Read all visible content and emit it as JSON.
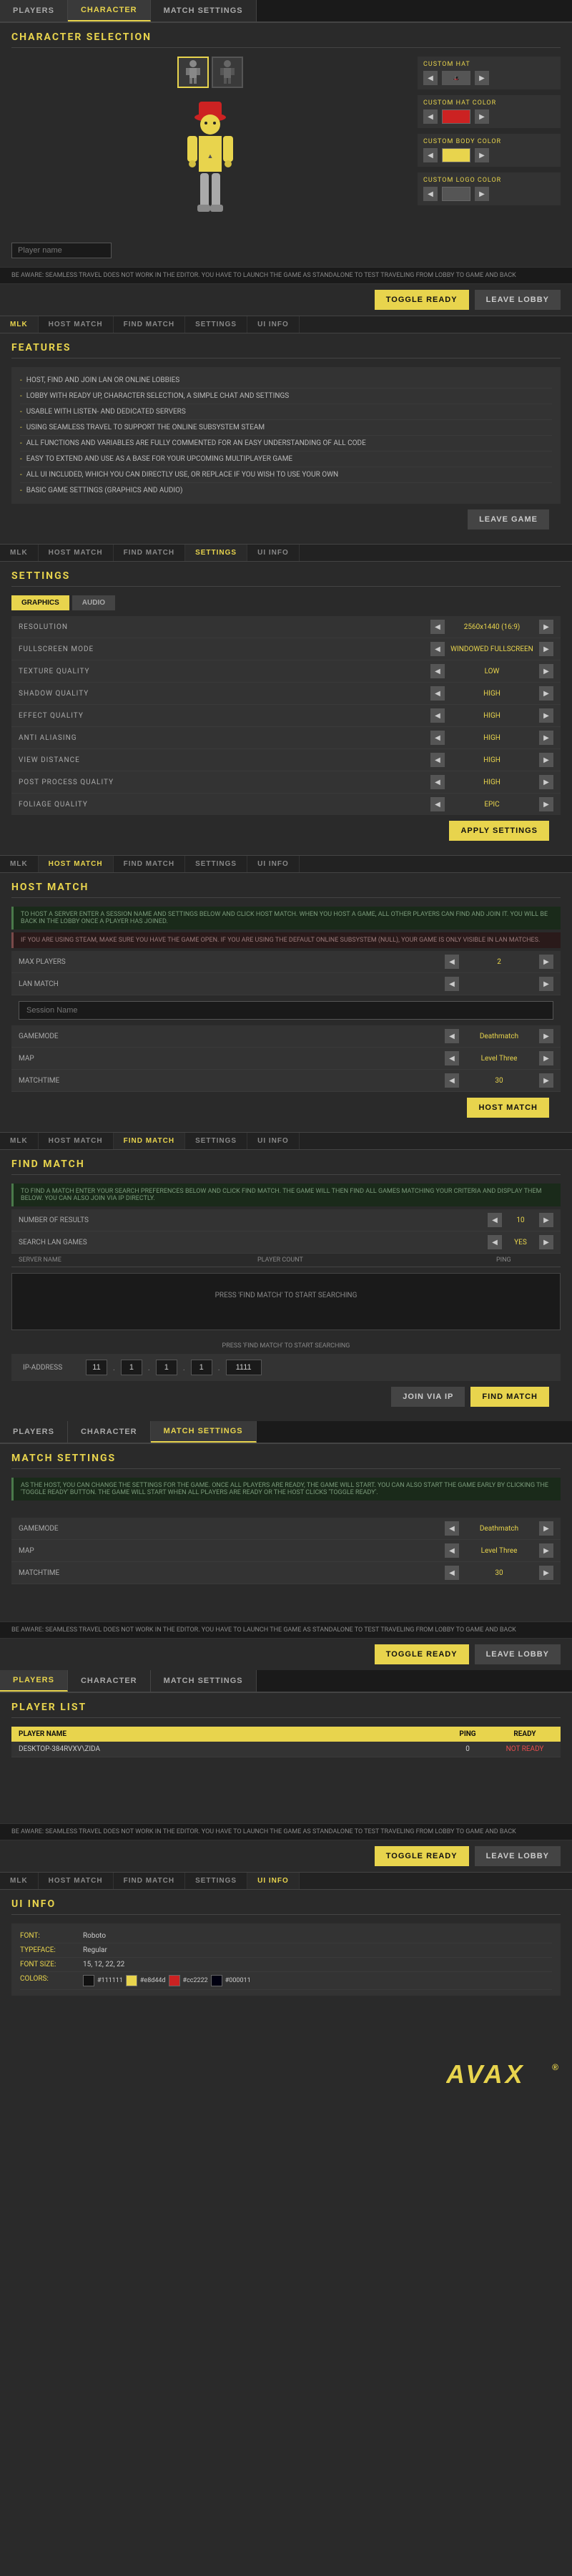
{
  "topNav": {
    "tabs": [
      "PLAYERS",
      "CHARACTER",
      "MATCH SETTINGS"
    ]
  },
  "charSection": {
    "title": "CHARACTER SELECTION",
    "thumbs": [
      "char1",
      "char2"
    ],
    "nameInputPlaceholder": "Player name",
    "customHat": {
      "label": "CUSTOM HAT",
      "value": "Hat 1"
    },
    "customHatColor": {
      "label": "CUSTOM HAT COLOR",
      "color": "#cc2222"
    },
    "customBodyColor": {
      "label": "CUSTOM BODY COLOR",
      "color": "#e8d44d"
    },
    "customLogoColor": {
      "label": "CUSTOM LOGO COLOR",
      "color": "#555555"
    },
    "warningText": "BE AWARE: SEAMLESS TRAVEL DOES NOT WORK IN THE EDITOR. YOU HAVE TO LAUNCH THE GAME AS STANDALONE TO TEST TRAVELING FROM LOBBY TO GAME AND BACK",
    "toggleReadyLabel": "TOGGLE READY",
    "leaveLobbyLabel": "LEAVE LOBBY"
  },
  "subNav": {
    "tabs": [
      "MLK",
      "HOST MATCH",
      "FIND MATCH",
      "SETTINGS",
      "UI INFO"
    ]
  },
  "features": {
    "title": "FEATURES",
    "items": [
      "HOST, FIND AND JOIN LAN OR ONLINE LOBBIES",
      "LOBBY WITH READY UP, CHARACTER SELECTION, A SIMPLE CHAT AND SETTINGS",
      "USABLE WITH LISTEN- AND DEDICATED SERVERS",
      "USING SEAMLESS TRAVEL TO SUPPORT THE ONLINE SUBSYSTEM STEAM",
      "ALL FUNCTIONS AND VARIABLES ARE FULLY COMMENTED FOR AN EASY UNDERSTANDING OF ALL CODE",
      "EASY TO EXTEND AND USE AS A BASE FOR YOUR UPCOMING MULTIPLAYER GAME",
      "ALL UI INCLUDED, WHICH YOU CAN DIRECTLY USE, OR REPLACE IF YOU WISH TO USE YOUR OWN",
      "BASIC GAME SETTINGS (GRAPHICS AND AUDIO)"
    ],
    "leaveGameLabel": "LEAVE GAME"
  },
  "settings": {
    "title": "SETTINGS",
    "tabs": [
      "GRAPHICS",
      "AUDIO"
    ],
    "rows": [
      {
        "label": "RESOLUTION",
        "value": "2560x1440 (16:9)"
      },
      {
        "label": "FULLSCREEN MODE",
        "value": "WINDOWED FULLSCREEN"
      },
      {
        "label": "TEXTURE QUALITY",
        "value": "LOW"
      },
      {
        "label": "SHADOW QUALITY",
        "value": "HIGH"
      },
      {
        "label": "EFFECT QUALITY",
        "value": "HIGH"
      },
      {
        "label": "ANTI ALIASING",
        "value": "HIGH"
      },
      {
        "label": "VIEW DISTANCE",
        "value": "HIGH"
      },
      {
        "label": "POST PROCESS QUALITY",
        "value": "HIGH"
      },
      {
        "label": "FOLIAGE QUALITY",
        "value": "EPIC"
      }
    ],
    "applyLabel": "APPLY SETTINGS"
  },
  "hostMatch": {
    "title": "HOST MATCH",
    "infoText": "TO HOST A SERVER ENTER A SESSION NAME AND SETTINGS BELOW AND CLICK HOST MATCH. WHEN YOU HOST A GAME, ALL OTHER PLAYERS CAN FIND AND JOIN IT. YOU WILL BE BACK IN THE LOBBY ONCE A PLAYER HAS JOINED.",
    "warnText": "IF YOU ARE USING STEAM, MAKE SURE YOU HAVE THE GAME OPEN. IF YOU ARE USING THE DEFAULT ONLINE SUBSYSTEM (NULL), YOUR GAME IS ONLY VISIBLE IN LAN MATCHES.",
    "rows": [
      {
        "label": "MAX PLAYERS",
        "value": "2"
      },
      {
        "label": "LAN MATCH",
        "value": ""
      }
    ],
    "sessionName": "",
    "gamemodeLabel": "GAMEMODE",
    "gamemodeValue": "Deathmatch",
    "mapLabel": "MAP",
    "mapValue": "Level Three",
    "matchtimeLabel": "MATCHTIME",
    "matchtimeValue": "30",
    "hostMatchLabel": "HOST MATCH"
  },
  "findMatch": {
    "title": "FIND MATCH",
    "infoText": "TO FIND A MATCH ENTER YOUR SEARCH PREFERENCES BELOW AND CLICK FIND MATCH. THE GAME WILL THEN FIND ALL GAMES MATCHING YOUR CRITERIA AND DISPLAY THEM BELOW. YOU CAN ALSO JOIN VIA IP DIRECTLY.",
    "rows": [
      {
        "label": "NUMBER OF RESULTS",
        "value": "10"
      },
      {
        "label": "SEARCH LAN GAMES",
        "value": "YES"
      }
    ],
    "serverNameLabel": "SERVER NAME",
    "playerCountLabel": "PLAYER COUNT",
    "pingLabel": "PING",
    "noResultsText": "PRESS 'FIND MATCH' TO START SEARCHING",
    "ipLabel": "IP-ADDRESS",
    "ipOctet1": "11",
    "ipOctet2": "1",
    "ipOctet3": "1",
    "ipOctet4": "1",
    "ipOctet5": "1111",
    "joinViaIpLabel": "JOIN VIA IP",
    "findMatchLabel": "FIND MATCH"
  },
  "matchSettings": {
    "topNav": [
      "PLAYERS",
      "CHARACTER",
      "MATCH SETTINGS"
    ],
    "title": "MATCH SETTINGS",
    "infoText": "AS THE HOST, YOU CAN CHANGE THE SETTINGS FOR THE GAME. ONCE ALL PLAYERS ARE READY, THE GAME WILL START. YOU CAN ALSO START THE GAME EARLY BY CLICKING THE 'TOGGLE READY' BUTTON. THE GAME WILL START WHEN ALL PLAYERS ARE READY OR THE HOST CLICKS 'TOGGLE READY'.",
    "rows": [
      {
        "label": "GAMEMODE",
        "value": "Deathmatch"
      },
      {
        "label": "MAP",
        "value": "Level Three"
      },
      {
        "label": "MATCHTIME",
        "value": "30"
      }
    ],
    "warningText": "BE AWARE: SEAMLESS TRAVEL DOES NOT WORK IN THE EDITOR. YOU HAVE TO LAUNCH THE GAME AS STANDALONE TO TEST TRAVELING FROM LOBBY TO GAME AND BACK",
    "toggleReadyLabel": "TOGGLE READY",
    "leaveLobbyLabel": "LEAVE LOBBY"
  },
  "playerList": {
    "topNav": [
      "PLAYERS",
      "CHARACTER",
      "MATCH SETTINGS"
    ],
    "title": "PLAYER LIST",
    "columns": [
      "PLAYER NAME",
      "PING",
      "READY"
    ],
    "rows": [
      {
        "name": "DESKTOP-384RVXV\\ZIDA",
        "ping": "0",
        "ready": "NOT READY"
      }
    ],
    "warningText": "BE AWARE: SEAMLESS TRAVEL DOES NOT WORK IN THE EDITOR. YOU HAVE TO LAUNCH THE GAME AS STANDALONE TO TEST TRAVELING FROM LOBBY TO GAME AND BACK",
    "toggleReadyLabel": "TOGGLE READY",
    "leaveLobbyLabel": "LEAVE LOBBY"
  },
  "uiInfo": {
    "title": "UI INFO",
    "rows": [
      {
        "label": "FONT:",
        "value": "Roboto"
      },
      {
        "label": "TYPEFACE:",
        "value": "Regular"
      },
      {
        "label": "FONT SIZE:",
        "value": "15, 12, 22, 22"
      },
      {
        "label": "COLORS:",
        "values": [
          "#111111",
          "#e8d44d",
          "#cc2222",
          "#000011"
        ]
      }
    ]
  },
  "avaxLogo": {
    "text": "AVAX",
    "suffix": "®"
  }
}
